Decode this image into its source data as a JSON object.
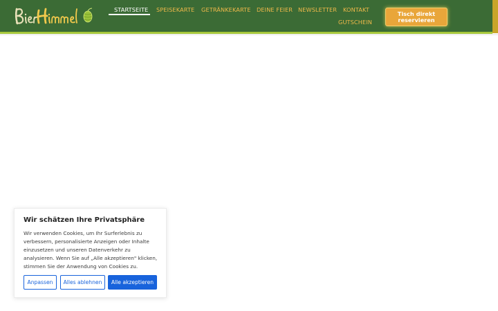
{
  "header": {
    "logo_text": "BierHimmel",
    "nav": [
      {
        "label": "STARTSEITE",
        "active": true
      },
      {
        "label": "SPEISEKARTE",
        "active": false
      },
      {
        "label": "GETRÄNKEKARTE",
        "active": false
      },
      {
        "label": "DEINE FEIER",
        "active": false
      },
      {
        "label": "NEWSLETTER",
        "active": false
      },
      {
        "label": "KONTAKT",
        "active": false
      },
      {
        "label": "GUTSCHEIN",
        "active": false
      }
    ],
    "reserve_line1": "Tisch direkt",
    "reserve_line2": "reservieren"
  },
  "cookie_banner": {
    "title": "Wir schätzen Ihre Privatsphäre",
    "text": "Wir verwenden Cookies, um Ihr Surferlebnis zu verbessern, personalisierte Anzeigen oder Inhalte einzusetzen und unseren Datenverkehr zu analysieren. Wenn Sie auf „Alle akzeptieren\" klicken, stimmen Sie der Anwendung von Cookies zu.",
    "btn_customize": "Anpassen",
    "btn_reject": "Alles ablehnen",
    "btn_accept": "Alle akzeptieren"
  },
  "colors": {
    "header_bg": "#3b6b35",
    "nav_text": "#f0b94a",
    "accent_button": "#e9a63a",
    "cookie_primary": "#1863dc"
  }
}
